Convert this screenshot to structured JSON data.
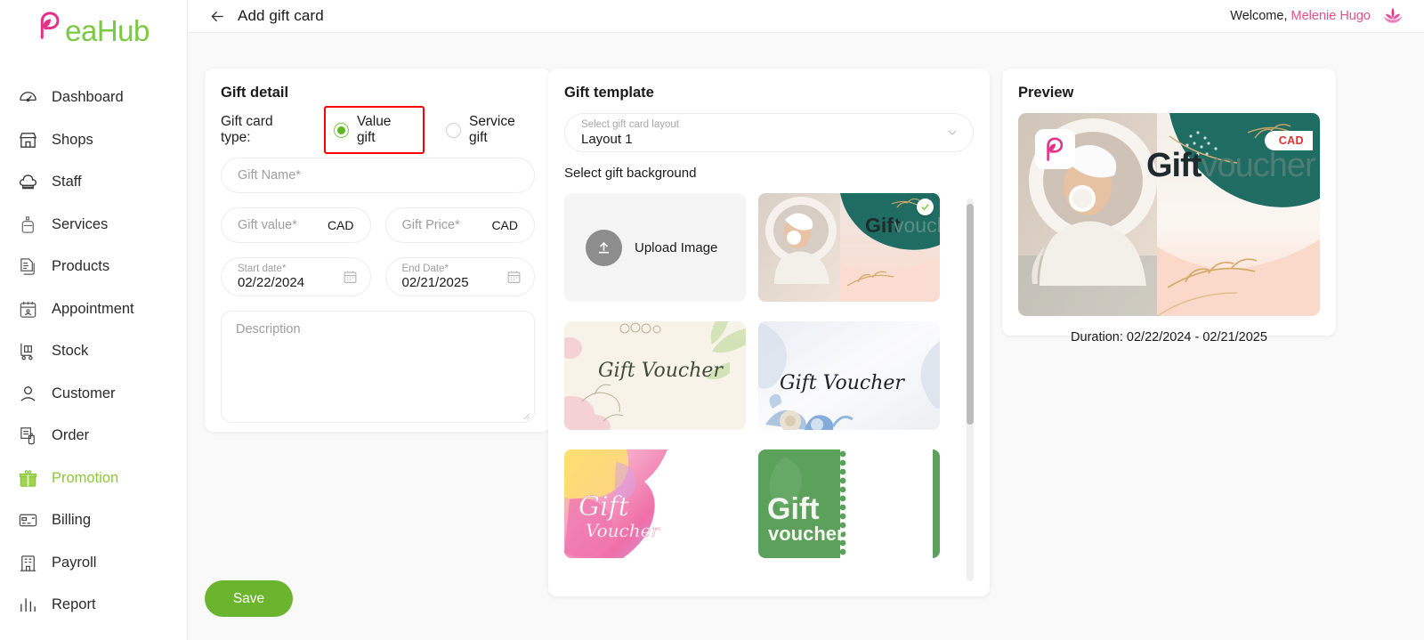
{
  "brand": {
    "name_part1": "B",
    "name_part2": "eaHub",
    "pink": "#e5308a",
    "green": "#7ac943"
  },
  "sidebar": {
    "items": [
      {
        "label": "Dashboard",
        "icon": "gauge-icon",
        "active": false
      },
      {
        "label": "Shops",
        "icon": "store-icon",
        "active": false
      },
      {
        "label": "Staff",
        "icon": "chef-hat-icon",
        "active": false
      },
      {
        "label": "Services",
        "icon": "lotion-bottle-icon",
        "active": false
      },
      {
        "label": "Products",
        "icon": "documents-icon",
        "active": false
      },
      {
        "label": "Appointment",
        "icon": "calendar-appointment-icon",
        "active": false
      },
      {
        "label": "Stock",
        "icon": "hand-truck-icon",
        "active": false
      },
      {
        "label": "Customer",
        "icon": "person-icon",
        "active": false
      },
      {
        "label": "Order",
        "icon": "order-list-icon",
        "active": false
      },
      {
        "label": "Promotion",
        "icon": "gift-box-icon",
        "active": true
      },
      {
        "label": "Billing",
        "icon": "credit-card-icon",
        "active": false
      },
      {
        "label": "Payroll",
        "icon": "building-icon",
        "active": false
      },
      {
        "label": "Report",
        "icon": "bar-chart-icon",
        "active": false
      }
    ]
  },
  "topbar": {
    "back_icon": "arrow-left-icon",
    "title": "Add gift card",
    "welcome_prefix": "Welcome,",
    "user_name": "Melenie Hugo",
    "avatar_icon": "lotus-icon"
  },
  "gift_detail": {
    "title": "Gift detail",
    "type_label": "Gift card type:",
    "options": [
      {
        "label": "Value gift",
        "selected": true,
        "highlighted": true
      },
      {
        "label": "Service gift",
        "selected": false,
        "highlighted": false
      }
    ],
    "gift_name": {
      "placeholder": "Gift Name*",
      "value": ""
    },
    "gift_value": {
      "placeholder": "Gift value*",
      "value": "",
      "currency": "CAD"
    },
    "gift_price": {
      "placeholder": "Gift Price*",
      "value": "",
      "currency": "CAD"
    },
    "start_date": {
      "label": "Start date*",
      "value": "02/22/2024",
      "icon": "calendar-icon"
    },
    "end_date": {
      "label": "End Date*",
      "value": "02/21/2025",
      "icon": "calendar-icon"
    },
    "description": {
      "placeholder": "Description",
      "value": ""
    },
    "save_label": "Save",
    "save_color": "#6ab42e"
  },
  "gift_template": {
    "title": "Gift template",
    "layout_select": {
      "label": "Select gift card layout",
      "value": "Layout 1",
      "icon": "chevron-down-icon"
    },
    "background_label": "Select gift background",
    "upload": {
      "label": "Upload Image",
      "icon": "upload-icon"
    },
    "backgrounds": [
      {
        "name": "spa-woman-giftvoucher",
        "selected": true,
        "caption_bold": "Gift",
        "caption_light": "voucher"
      },
      {
        "name": "floral-green-gift-voucher",
        "selected": false,
        "caption": "Gift Voucher"
      },
      {
        "name": "blue-floral-gift-voucher",
        "selected": false,
        "caption": "Gift Voucher"
      },
      {
        "name": "pink-watercolor-gift-voucher",
        "selected": false,
        "caption_bold": "Gift",
        "caption_light": "Voucher"
      },
      {
        "name": "green-ticket-gift-voucher",
        "selected": false,
        "caption_bold": "Gift",
        "caption_light": "voucher"
      }
    ],
    "scrollbar": {
      "name": "template-scrollbar"
    }
  },
  "preview": {
    "title": "Preview",
    "currency_badge": "CAD",
    "voucher_text_bold": "Gift",
    "voucher_text_light": "voucher",
    "duration": "Duration: 02/22/2024 - 02/21/2025"
  }
}
